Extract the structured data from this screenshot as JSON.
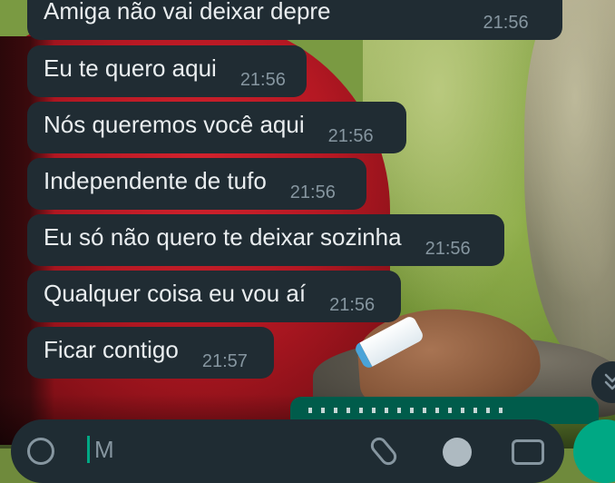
{
  "messages": [
    {
      "text": "Amiga não vai deixar depre",
      "time": "21:56"
    },
    {
      "text": "Eu te quero aqui",
      "time": "21:56"
    },
    {
      "text": "Nós queremos você aqui",
      "time": "21:56"
    },
    {
      "text": "Independente de tufo",
      "time": "21:56"
    },
    {
      "text": "Eu só não quero te deixar sozinha",
      "time": "21:56"
    },
    {
      "text": "Qualquer coisa eu vou aí",
      "time": "21:56"
    },
    {
      "text": "Ficar contigo",
      "time": "21:57"
    }
  ],
  "input": {
    "placeholder": "M"
  },
  "icons": {
    "scroll_down": "chevron-double-down-icon",
    "emoji": "emoji-icon",
    "attach": "paperclip-icon",
    "pay": "payment-icon",
    "camera": "camera-icon",
    "mic": "microphone-icon"
  },
  "colors": {
    "bubble_incoming": "#202c33",
    "bubble_outgoing": "#005c4b",
    "text_primary": "#e9edef",
    "text_meta": "#8696a0",
    "accent": "#00a884"
  }
}
